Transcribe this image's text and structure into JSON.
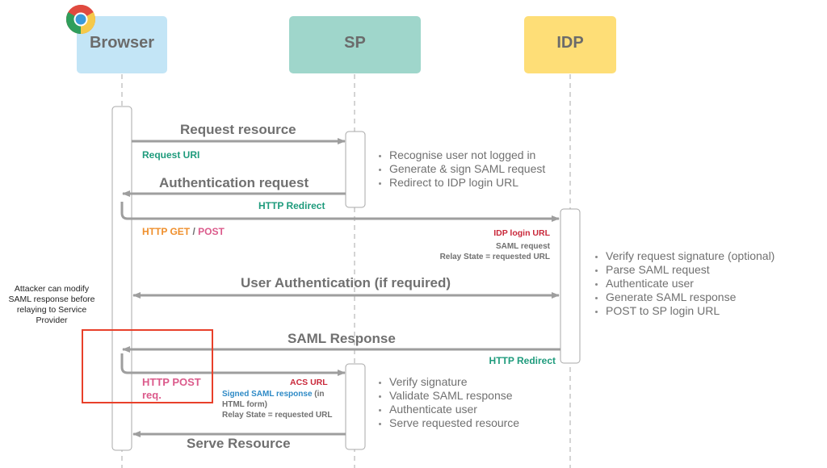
{
  "actors": {
    "browser": {
      "label": "Browser",
      "color": "#c3e5f6",
      "icon": "chrome-icon"
    },
    "sp": {
      "label": "SP",
      "color": "#9fd6cb"
    },
    "idp": {
      "label": "IDP",
      "color": "#fede77"
    }
  },
  "messages": {
    "request_resource": {
      "title": "Request resource",
      "sub": "Request URI"
    },
    "auth_request": {
      "title": "Authentication request",
      "sub": "HTTP Redirect"
    },
    "http_get_post": {
      "get": "HTTP GET",
      "slash": "/",
      "post": "POST"
    },
    "idp_login": {
      "url": "IDP login URL",
      "line1": "SAML request",
      "line2": "Relay State = requested URL"
    },
    "user_auth": {
      "title": "User Authentication (if required)"
    },
    "saml_response": {
      "title": "SAML Response",
      "sub": "HTTP Redirect"
    },
    "http_post": {
      "line1": "HTTP POST",
      "line2": "req."
    },
    "acs": {
      "url": "ACS URL",
      "signed": "Signed SAML response",
      "in": " (in",
      "form": "HTML form)",
      "relay": "Relay State = requested URL"
    },
    "serve_resource": {
      "title": "Serve Resource"
    }
  },
  "notes": {
    "sp_first": [
      "Recognise user not logged in",
      "Generate & sign SAML request",
      "Redirect to IDP login URL"
    ],
    "idp": [
      "Verify request signature (optional)",
      "Parse SAML request",
      "Authenticate user",
      "Generate SAML response",
      "POST to SP login URL"
    ],
    "sp_second": [
      "Verify signature",
      "Validate SAML response",
      "Authenticate user",
      "Serve requested resource"
    ]
  },
  "annotation": {
    "text": "Attacker can modify SAML response before relaying to Service Provider",
    "highlight_color": "#e8402a"
  },
  "colors": {
    "arrow": "#9e9e9e",
    "lifeline": "#aaaaaa"
  }
}
